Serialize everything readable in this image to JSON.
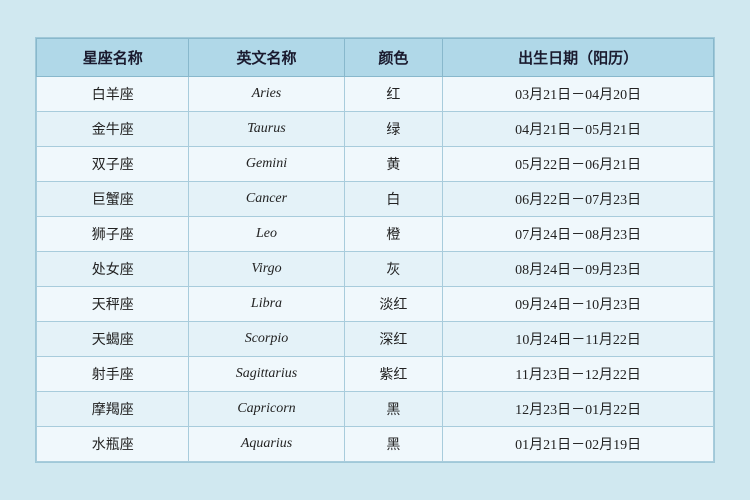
{
  "table": {
    "headers": [
      "星座名称",
      "英文名称",
      "颜色",
      "出生日期（阳历）"
    ],
    "rows": [
      {
        "chinese": "白羊座",
        "english": "Aries",
        "color": "红",
        "date": "03月21日－04月20日"
      },
      {
        "chinese": "金牛座",
        "english": "Taurus",
        "color": "绿",
        "date": "04月21日－05月21日"
      },
      {
        "chinese": "双子座",
        "english": "Gemini",
        "color": "黄",
        "date": "05月22日－06月21日"
      },
      {
        "chinese": "巨蟹座",
        "english": "Cancer",
        "color": "白",
        "date": "06月22日－07月23日"
      },
      {
        "chinese": "狮子座",
        "english": "Leo",
        "color": "橙",
        "date": "07月24日－08月23日"
      },
      {
        "chinese": "处女座",
        "english": "Virgo",
        "color": "灰",
        "date": "08月24日－09月23日"
      },
      {
        "chinese": "天秤座",
        "english": "Libra",
        "color": "淡红",
        "date": "09月24日－10月23日"
      },
      {
        "chinese": "天蝎座",
        "english": "Scorpio",
        "color": "深红",
        "date": "10月24日－11月22日"
      },
      {
        "chinese": "射手座",
        "english": "Sagittarius",
        "color": "紫红",
        "date": "11月23日－12月22日"
      },
      {
        "chinese": "摩羯座",
        "english": "Capricorn",
        "color": "黑",
        "date": "12月23日－01月22日"
      },
      {
        "chinese": "水瓶座",
        "english": "Aquarius",
        "color": "黑",
        "date": "01月21日－02月19日"
      }
    ]
  }
}
